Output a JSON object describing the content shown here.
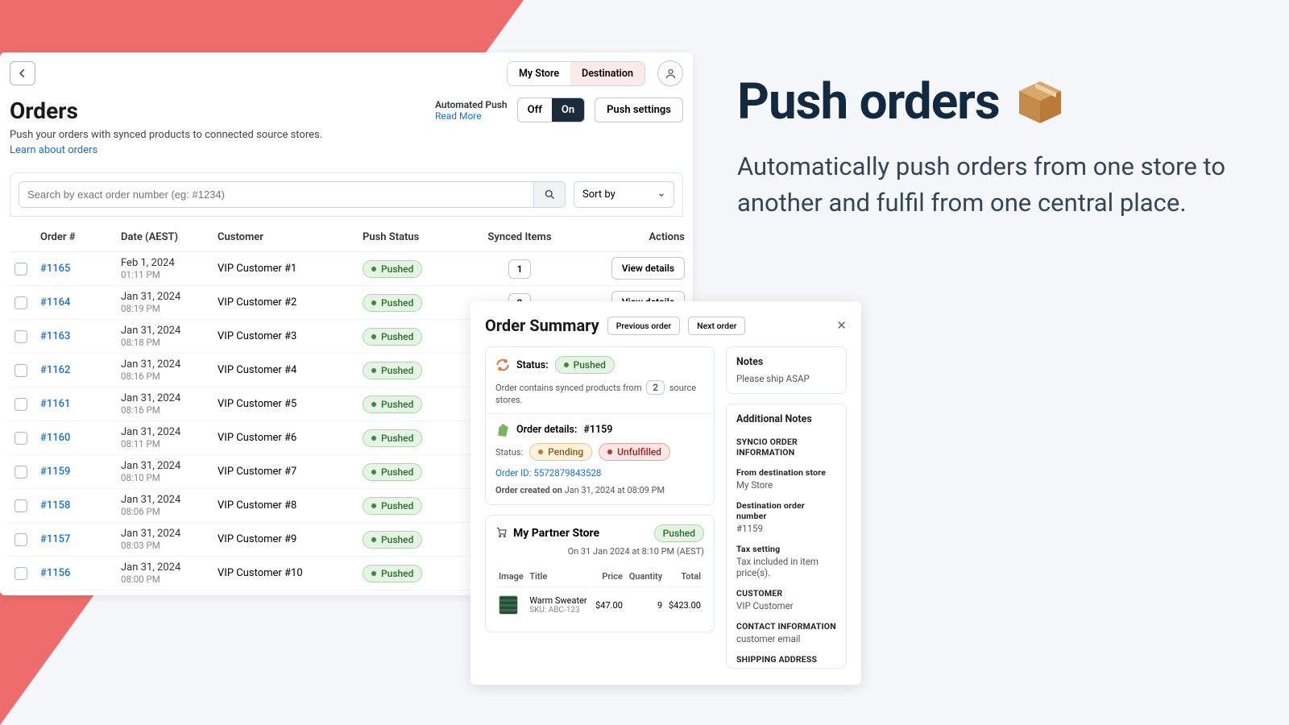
{
  "hero": {
    "title": "Push orders",
    "subtitle": "Automatically push orders from one store to another and fulfil from one central place."
  },
  "topbar": {
    "my_store": "My Store",
    "destination": "Destination"
  },
  "page": {
    "title": "Orders",
    "subtitle": "Push your orders with synced products to connected source stores.",
    "learn_link": "Learn about orders",
    "auto_push_label": "Automated Push",
    "read_more": "Read More",
    "toggle_off": "Off",
    "toggle_on": "On",
    "push_settings": "Push settings"
  },
  "controls": {
    "search_placeholder": "Search by exact order number (eg: #1234)",
    "sort_by": "Sort by"
  },
  "table": {
    "headers": {
      "order": "Order #",
      "date": "Date (AEST)",
      "customer": "Customer",
      "push_status": "Push Status",
      "synced": "Synced Items",
      "actions": "Actions"
    },
    "view_details": "View details",
    "pushed_label": "Pushed",
    "rows": [
      {
        "order": "#1165",
        "date": "Feb 1, 2024",
        "time": "01:11 PM",
        "customer": "VIP Customer #1",
        "synced": "1"
      },
      {
        "order": "#1164",
        "date": "Jan 31, 2024",
        "time": "08:19 PM",
        "customer": "VIP Customer #2",
        "synced": "2"
      },
      {
        "order": "#1163",
        "date": "Jan 31, 2024",
        "time": "08:18 PM",
        "customer": "VIP Customer #3"
      },
      {
        "order": "#1162",
        "date": "Jan 31, 2024",
        "time": "08:16 PM",
        "customer": "VIP Customer #4"
      },
      {
        "order": "#1161",
        "date": "Jan 31, 2024",
        "time": "08:16 PM",
        "customer": "VIP Customer #5"
      },
      {
        "order": "#1160",
        "date": "Jan 31, 2024",
        "time": "08:11 PM",
        "customer": "VIP Customer #6"
      },
      {
        "order": "#1159",
        "date": "Jan 31, 2024",
        "time": "08:10 PM",
        "customer": "VIP Customer #7"
      },
      {
        "order": "#1158",
        "date": "Jan 31, 2024",
        "time": "08:06 PM",
        "customer": "VIP Customer #8"
      },
      {
        "order": "#1157",
        "date": "Jan 31, 2024",
        "time": "08:03 PM",
        "customer": "VIP Customer #9"
      },
      {
        "order": "#1156",
        "date": "Jan 31, 2024",
        "time": "08:00 PM",
        "customer": "VIP Customer #10"
      }
    ]
  },
  "summary": {
    "title": "Order Summary",
    "prev": "Previous order",
    "next": "Next order",
    "status_label": "Status:",
    "status_badge": "Pushed",
    "contains_pre": "Order contains synced products from",
    "contains_count": "2",
    "contains_post": "source stores.",
    "order_details_label": "Order details:",
    "order_details_num": "#1159",
    "status2_label": "Status:",
    "pending": "Pending",
    "unfulfilled": "Unfulfilled",
    "order_id_label": "Order ID:",
    "order_id": "5572879843528",
    "created_label": "Order created on",
    "created_value": "Jan 31, 2024 at 08:09 PM",
    "partner": {
      "name": "My Partner Store",
      "badge": "Pushed",
      "date": "On 31 Jan 2024 at 8:10 PM (AEST)",
      "headers": {
        "image": "Image",
        "title": "Title",
        "price": "Price",
        "qty": "Quantity",
        "total": "Total"
      },
      "item": {
        "title": "Warm Sweater",
        "sku": "SKU: ABC-123",
        "price": "$47.00",
        "qty": "9",
        "total": "$423.00"
      }
    }
  },
  "sidebar": {
    "notes_h": "Notes",
    "notes_t": "Please ship ASAP",
    "addl_h": "Additional Notes",
    "syncio_h": "SYNCIO ORDER INFORMATION",
    "from_h": "From destination store",
    "from_v": "My Store",
    "don_h": "Destination order number",
    "don_v": "#1159",
    "tax_h": "Tax setting",
    "tax_v": "Tax included in item price(s).",
    "cust_h": "CUSTOMER",
    "cust_v": "VIP Customer",
    "contact_h": "CONTACT INFORMATION",
    "contact_v": "customer email",
    "ship_h": "SHIPPING ADDRESS"
  }
}
